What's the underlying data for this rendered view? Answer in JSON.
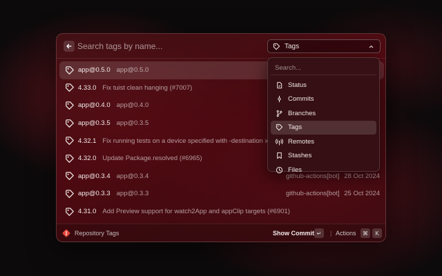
{
  "header": {
    "search_placeholder": "Search tags by name...",
    "dropdown_label": "Tags"
  },
  "tags": [
    {
      "name": "app@0.5.0",
      "message": "app@0.5.0",
      "author": "",
      "date": "",
      "selected": true
    },
    {
      "name": "4.33.0",
      "message": "Fix tuist clean hanging (#7007)",
      "author": "",
      "date": ""
    },
    {
      "name": "app@0.4.0",
      "message": "app@0.4.0",
      "author": "",
      "date": ""
    },
    {
      "name": "app@0.3.5",
      "message": "app@0.3.5",
      "author": "",
      "date": ""
    },
    {
      "name": "4.32.1",
      "message": "Fix running tests on a device specified with -destination xcode",
      "author": "",
      "date": ""
    },
    {
      "name": "4.32.0",
      "message": "Update Package.resolved (#6965)",
      "author": "",
      "date": ""
    },
    {
      "name": "app@0.3.4",
      "message": "app@0.3.4",
      "author": "github-actions[bot]",
      "date": "28 Oct 2024"
    },
    {
      "name": "app@0.3.3",
      "message": "app@0.3.3",
      "author": "github-actions[bot]",
      "date": "25 Oct 2024"
    },
    {
      "name": "4.31.0",
      "message": "Add Preview support for watch2App and appClip targets (#6901)",
      "author": "",
      "date": ""
    }
  ],
  "footer": {
    "title": "Repository Tags",
    "primary_action": "Show Commit",
    "primary_key": "↵",
    "actions_label": "Actions",
    "actions_key_1": "⌘",
    "actions_key_2": "K"
  },
  "menu": {
    "search_placeholder": "Search...",
    "items": [
      {
        "label": "Status",
        "icon": "file-status-icon"
      },
      {
        "label": "Commits",
        "icon": "commit-icon"
      },
      {
        "label": "Branches",
        "icon": "branch-icon"
      },
      {
        "label": "Tags",
        "icon": "tag-icon",
        "active": true
      },
      {
        "label": "Remotes",
        "icon": "broadcast-icon"
      },
      {
        "label": "Stashes",
        "icon": "bookmark-icon"
      },
      {
        "label": "Files",
        "icon": "clock-icon"
      }
    ]
  },
  "colors": {
    "accent_red": "#e5483f",
    "background": "#0d0a0b"
  }
}
